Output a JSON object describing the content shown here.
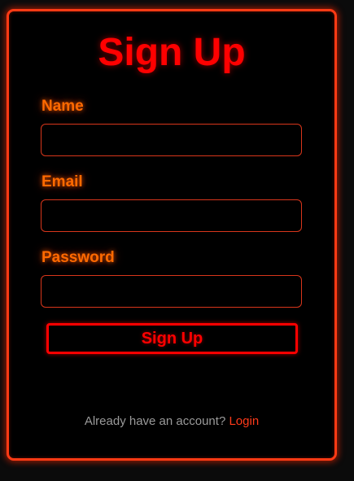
{
  "signup": {
    "title": "Sign Up",
    "fields": {
      "name": {
        "label": "Name",
        "value": ""
      },
      "email": {
        "label": "Email",
        "value": ""
      },
      "password": {
        "label": "Password",
        "value": ""
      }
    },
    "submit_label": "Sign Up",
    "footer": {
      "text": "Already have an account?",
      "link_label": "Login"
    }
  },
  "colors": {
    "background": "#000000",
    "border": "#ff3a14",
    "title": "#ff0000",
    "label": "#ff6a00",
    "link": "#ff3a1a",
    "muted_text": "#9a9a9a"
  }
}
